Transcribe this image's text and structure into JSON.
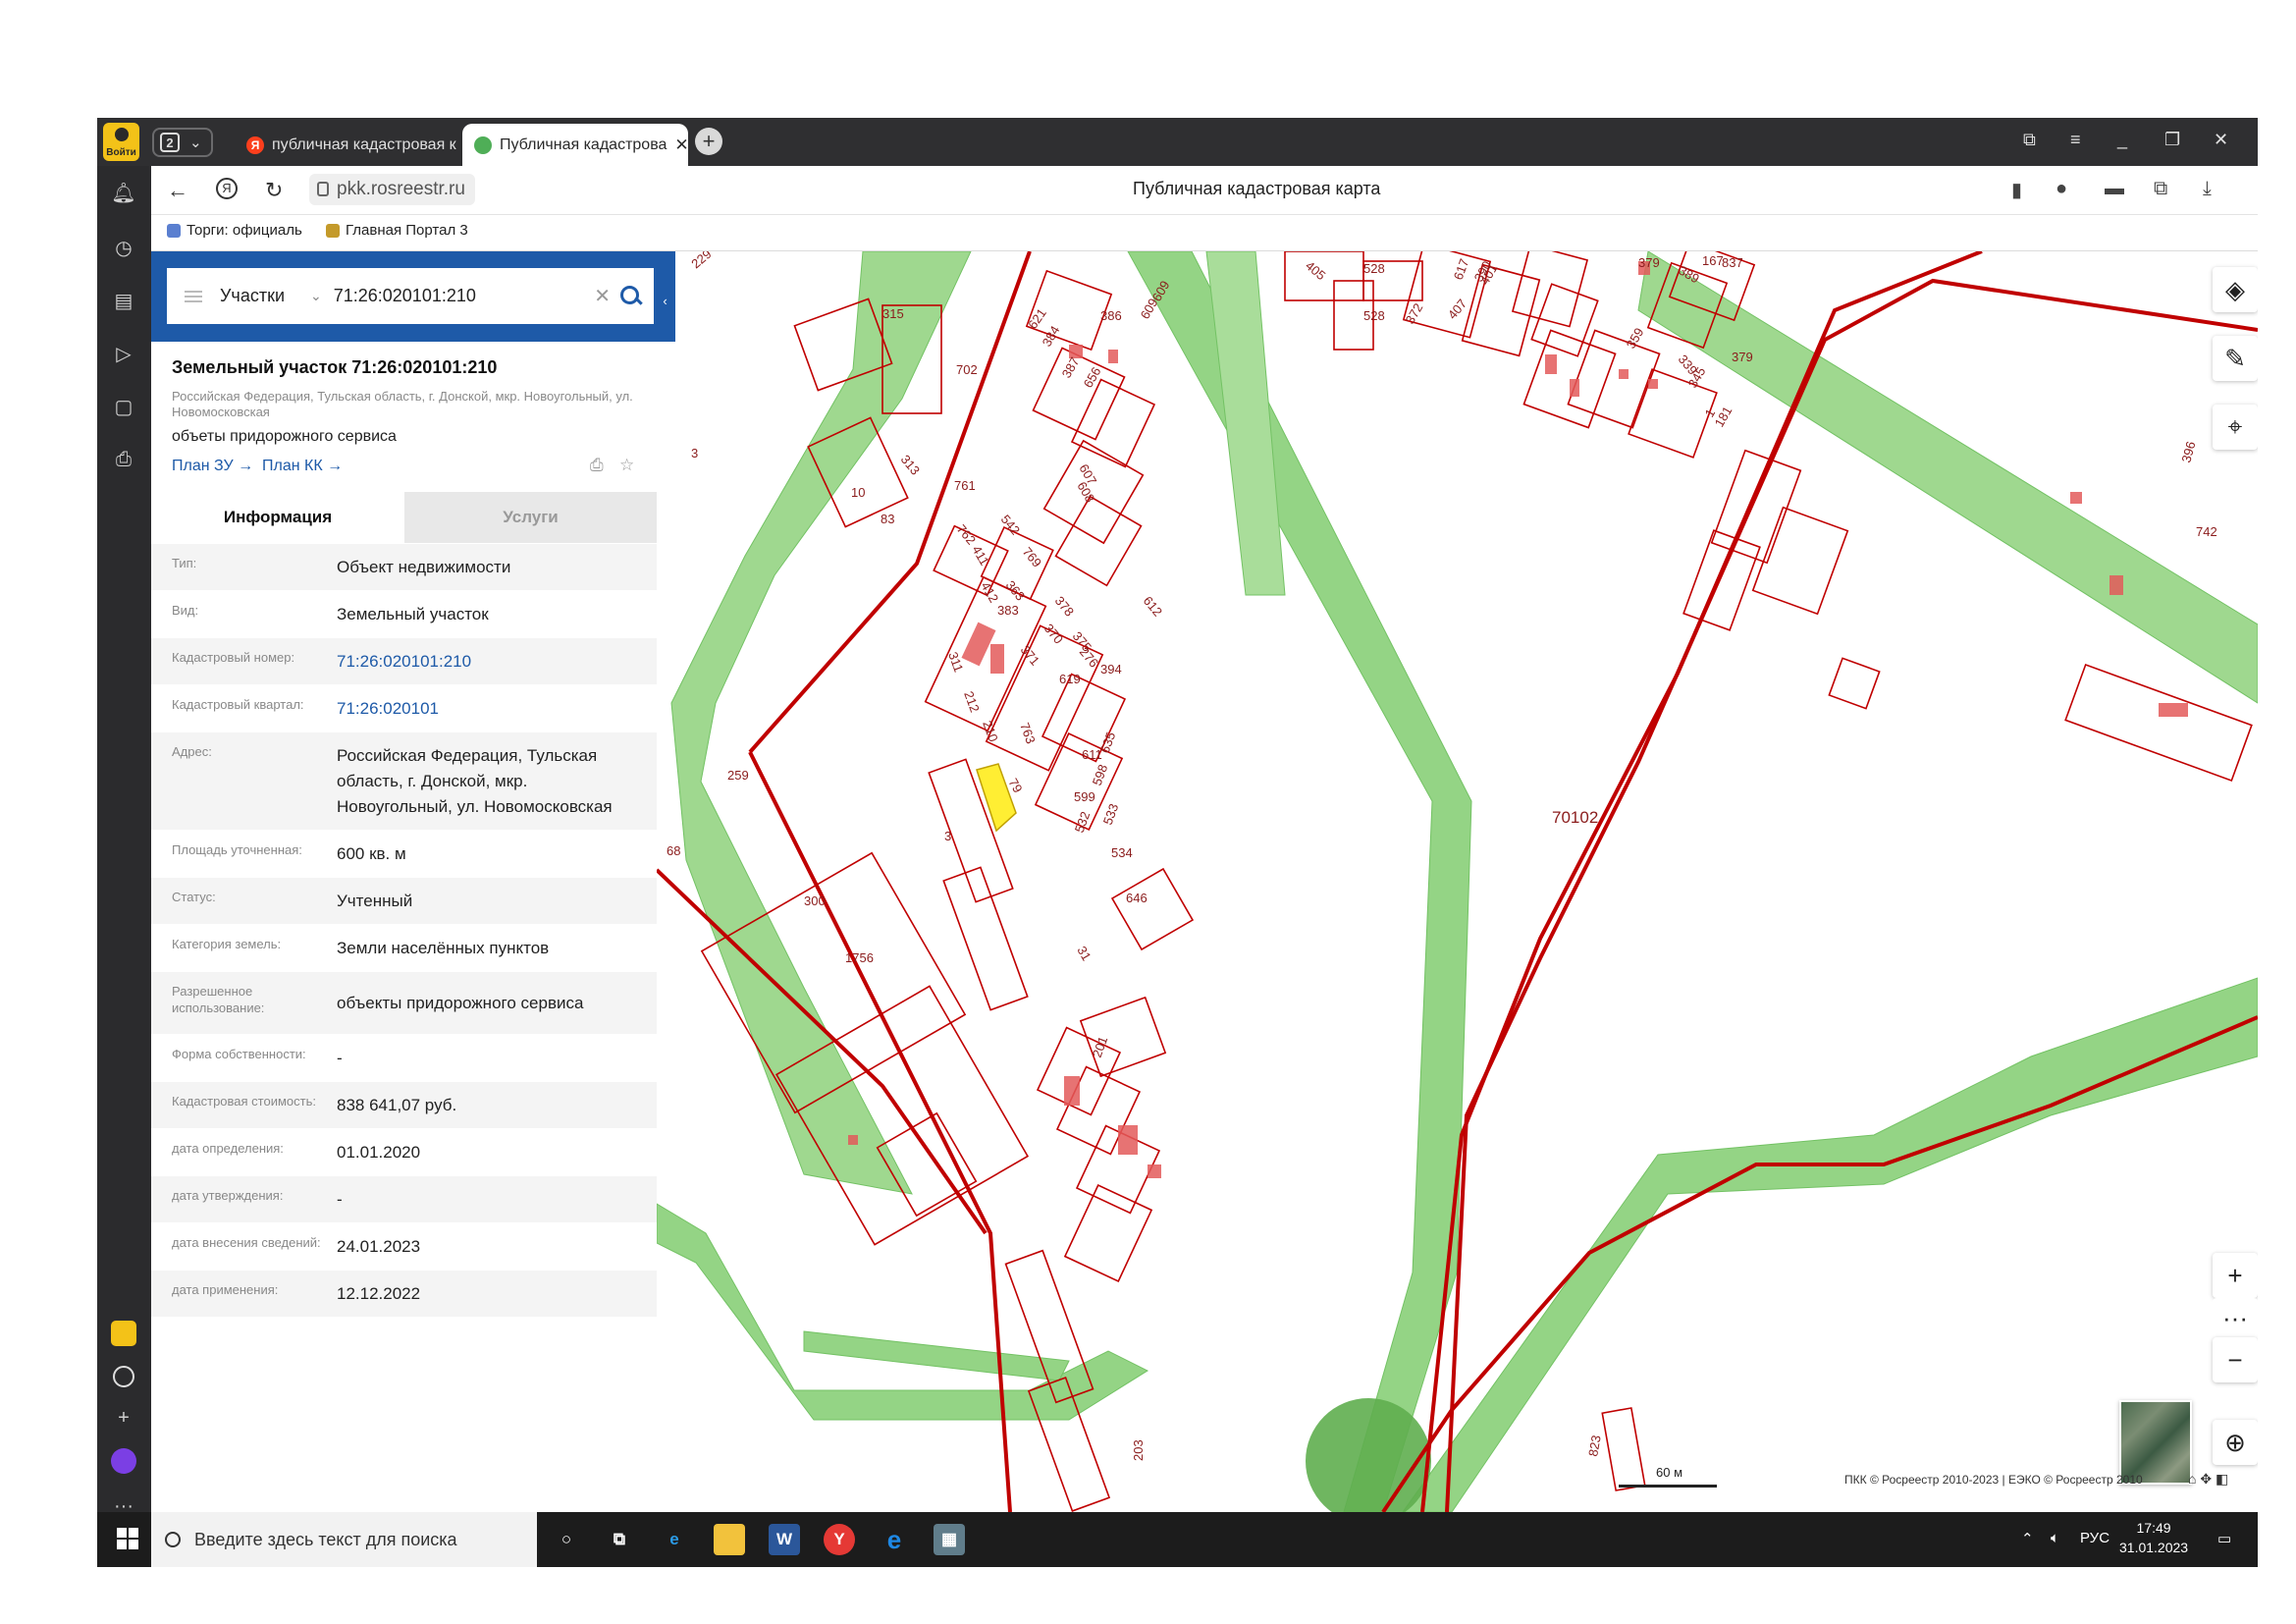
{
  "browser": {
    "login_label": "Войти",
    "tab_count": "2",
    "tabs": [
      {
        "title": "публичная кадастровая к"
      },
      {
        "title": "Публичная кадастрова"
      }
    ],
    "url": "pkk.rosreestr.ru",
    "page_title": "Публичная кадастровая карта",
    "bookmarks": [
      {
        "label": "Торги: официаль"
      },
      {
        "label": "Главная Портал 3"
      }
    ]
  },
  "search": {
    "type": "Участки",
    "value": "71:26:020101:210"
  },
  "object": {
    "title": "Земельный участок 71:26:020101:210",
    "address_short": "Российская Федерация, Тульская область, г. Донской, мкр. Новоугольный, ул. Новомосковская",
    "use": "объеты придорожного сервиса",
    "plan_zu": "План ЗУ →",
    "plan_kk": "План КК →"
  },
  "panel_tabs": {
    "info": "Информация",
    "services": "Услуги"
  },
  "attributes": [
    {
      "key": "Тип:",
      "value": "Объект недвижимости"
    },
    {
      "key": "Вид:",
      "value": "Земельный участок"
    },
    {
      "key": "Кадастровый номер:",
      "value": "71:26:020101:210"
    },
    {
      "key": "Кадастровый квартал:",
      "value": "71:26:020101"
    },
    {
      "key": "Адрес:",
      "value": "Российская Федерация, Тульская область, г. Донской, мкр. Новоугольный, ул. Новомосковская"
    },
    {
      "key": "Площадь уточненная:",
      "value": "600 кв. м"
    },
    {
      "key": "Статус:",
      "value": "Учтенный"
    },
    {
      "key": "Категория земель:",
      "value": "Земли населённых пунктов"
    },
    {
      "key": "Разрешенное использование:",
      "value": "объекты придорожного сервиса"
    },
    {
      "key": "Форма собственности:",
      "value": "-"
    },
    {
      "key": "Кадастровая стоимость:",
      "value": "838 641,07 руб."
    },
    {
      "key": "дата определения:",
      "value": "01.01.2020"
    },
    {
      "key": "дата утверждения:",
      "value": "-"
    },
    {
      "key": "дата внесения сведений:",
      "value": "24.01.2023"
    },
    {
      "key": "дата применения:",
      "value": "12.12.2022"
    }
  ],
  "map": {
    "quarter_label": "70102",
    "parcel_labels": [
      "229",
      "315",
      "702",
      "386",
      "621",
      "384",
      "387",
      "656",
      "405",
      "528",
      "617",
      "528",
      "372",
      "390",
      "407",
      "401",
      "609",
      "609",
      "379",
      "389",
      "167",
      "837",
      "359",
      "345",
      "1",
      "181",
      "379",
      "339",
      "3",
      "313",
      "10",
      "83",
      "761",
      "762",
      "542",
      "607",
      "608",
      "411",
      "412",
      "769",
      "363",
      "378",
      "612",
      "396",
      "742",
      "383",
      "370",
      "375",
      "276",
      "371",
      "311",
      "212",
      "210",
      "763",
      "619",
      "394",
      "259",
      "3",
      "611",
      "635",
      "598",
      "599",
      "532",
      "533",
      "534",
      "646",
      "68",
      "300",
      "1756",
      "79",
      "31",
      "201",
      "203",
      "823"
    ],
    "scale": "60 м",
    "copyright": "ПКК © Росреестр 2010-2023 | ЕЭКО © Росреестр 2010"
  },
  "taskbar": {
    "search_placeholder": "Введите здесь текст для поиска",
    "lang": "РУС",
    "time": "17:49",
    "date": "31.01.2023"
  },
  "colors": {
    "accent": "#1e5aa8",
    "parcel_border": "#c00000",
    "zone_green": "#8fd27f",
    "selected_parcel": "#ffee33"
  }
}
